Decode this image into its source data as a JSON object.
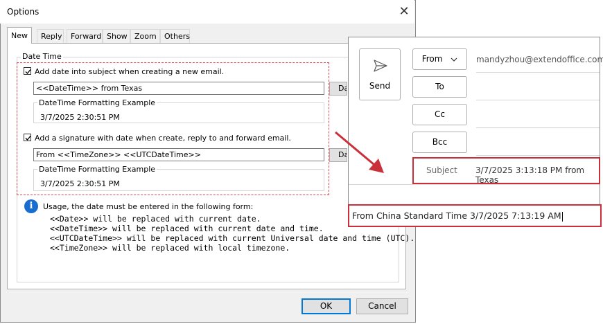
{
  "dialog": {
    "title": "Options",
    "tabs": [
      "New",
      "Reply",
      "Forward",
      "Show",
      "Zoom",
      "Others"
    ],
    "group_label": "Date Time",
    "subject_option": {
      "checkbox_label": "Add date into subject when creating a new email.",
      "checked": true,
      "template_value": "<<DateTime>> from Texas",
      "side_button_label": "Date",
      "example_label": "DateTime Formatting Example",
      "example_value": "3/7/2025 2:30:51 PM"
    },
    "signature_option": {
      "checkbox_label": "Add a signature with date when create, reply to and forward email.",
      "checked": true,
      "template_value": "From <<TimeZone>> <<UTCDateTime>>",
      "side_button_label": "Date",
      "example_label": "DateTime Formatting Example",
      "example_value": "3/7/2025 2:30:51 PM"
    },
    "usage": {
      "intro": "Usage, the date must be entered in the following form:",
      "lines": [
        "<<Date>> will be replaced with current date.",
        "<<DateTime>> will be replaced with current date and time.",
        "<<UTCDateTime>> will be replaced with current Universal date and time (UTC).",
        "<<TimeZone>> will be replaced with local timezone."
      ]
    },
    "ok_label": "OK",
    "cancel_label": "Cancel",
    "colors": {
      "highlight_border": "#e0474c",
      "info_icon": "#1a6dd0",
      "primary_button_border": "#0078d7"
    }
  },
  "mail": {
    "send_label": "Send",
    "from_label": "From",
    "from_address": "mandyzhou@extendoffice.com",
    "to_label": "To",
    "cc_label": "Cc",
    "bcc_label": "Bcc",
    "subject_label": "Subject",
    "subject_value": "3/7/2025 3:13:18 PM from Texas",
    "body_text": "From China Standard Time 3/7/2025 7:13:19 AM",
    "colors": {
      "highlight_border": "#c9303a",
      "arrow": "#c9303a"
    }
  }
}
